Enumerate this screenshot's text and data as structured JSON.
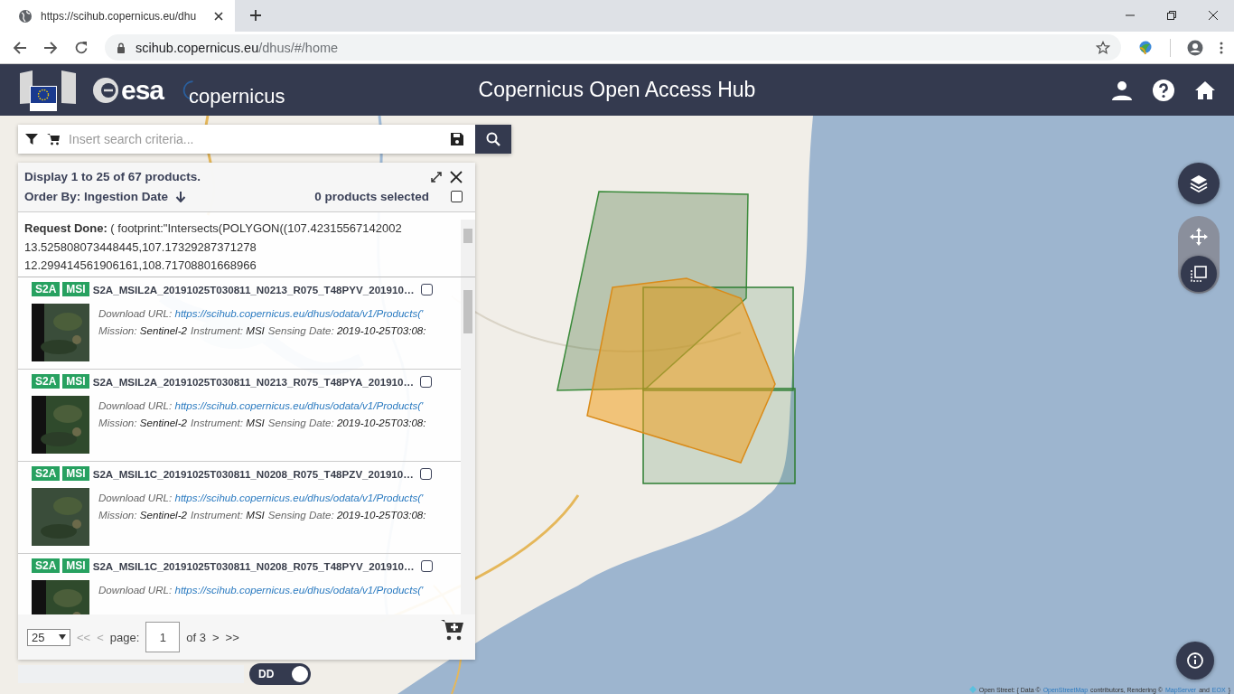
{
  "browser": {
    "tab_title": "https://scihub.copernicus.eu/dhu",
    "address_host": "scihub.copernicus.eu",
    "address_path": "/dhus/#/home"
  },
  "header": {
    "logos": [
      "esa",
      "copernicus"
    ],
    "title": "Copernicus Open Access Hub"
  },
  "search": {
    "placeholder": "Insert search criteria..."
  },
  "results": {
    "summary": "Display 1 to 25 of 67 products.",
    "order_by": "Order By: Ingestion Date",
    "selected_count": "0 products selected",
    "select_all_checked": false,
    "request": "**Request Done:** ( footprint:\"Intersects(POLYGON((107.42315567142002 13.525808073448445,107.17329287371278 12.299414561906161,108.71708801668966",
    "products": [
      {
        "badges": [
          "S2A",
          "MSI"
        ],
        "title": "S2A_MSIL2A_20191025T030811_N0213_R075_T48PYV_201910…",
        "selected": false,
        "url_label": "Download URL:",
        "url": "https://scihub.copernicus.eu/dhus/odata/v1/Products('",
        "details": [
          {
            "label": "Mission:",
            "value": "Sentinel-2"
          },
          {
            "label": "Instrument:",
            "value": "MSI"
          },
          {
            "label": "Sensing Date:",
            "value": "2019-10-25T03:08:"
          }
        ]
      },
      {
        "badges": [
          "S2A",
          "MSI"
        ],
        "title": "S2A_MSIL2A_20191025T030811_N0213_R075_T48PYA_201910…",
        "selected": false,
        "url_label": "Download URL:",
        "url": "https://scihub.copernicus.eu/dhus/odata/v1/Products('",
        "details": [
          {
            "label": "Mission:",
            "value": "Sentinel-2"
          },
          {
            "label": "Instrument:",
            "value": "MSI"
          },
          {
            "label": "Sensing Date:",
            "value": "2019-10-25T03:08:"
          }
        ]
      },
      {
        "badges": [
          "S2A",
          "MSI"
        ],
        "title": "S2A_MSIL1C_20191025T030811_N0208_R075_T48PZV_201910…",
        "selected": false,
        "url_label": "Download URL:",
        "url": "https://scihub.copernicus.eu/dhus/odata/v1/Products('",
        "details": [
          {
            "label": "Mission:",
            "value": "Sentinel-2"
          },
          {
            "label": "Instrument:",
            "value": "MSI"
          },
          {
            "label": "Sensing Date:",
            "value": "2019-10-25T03:08:"
          }
        ]
      },
      {
        "badges": [
          "S2A",
          "MSI"
        ],
        "title": "S2A_MSIL1C_20191025T030811_N0208_R075_T48PYV_201910…",
        "selected": false,
        "url_label": "Download URL:",
        "url": "https://scihub.copernicus.eu/dhus/odata/v1/Products('"
      }
    ],
    "pagination": {
      "page_size": "25",
      "first": "<<",
      "prev": "<",
      "page_label": "page:",
      "page": "1",
      "of": "of 3",
      "next": ">",
      "last": ">>"
    }
  },
  "toggle": {
    "label": "DD",
    "on": true
  },
  "attribution": {
    "parts": [
      {
        "kind": "text",
        "text": "Open Street: { Data ©"
      },
      {
        "kind": "link",
        "text": "OpenStreetMap"
      },
      {
        "kind": "text",
        "text": "contributors, Rendering ©"
      },
      {
        "kind": "link",
        "text": "MapServer"
      },
      {
        "kind": "text",
        "text": "and"
      },
      {
        "kind": "link",
        "text": "EOX"
      },
      {
        "kind": "text",
        "text": "}"
      }
    ]
  }
}
